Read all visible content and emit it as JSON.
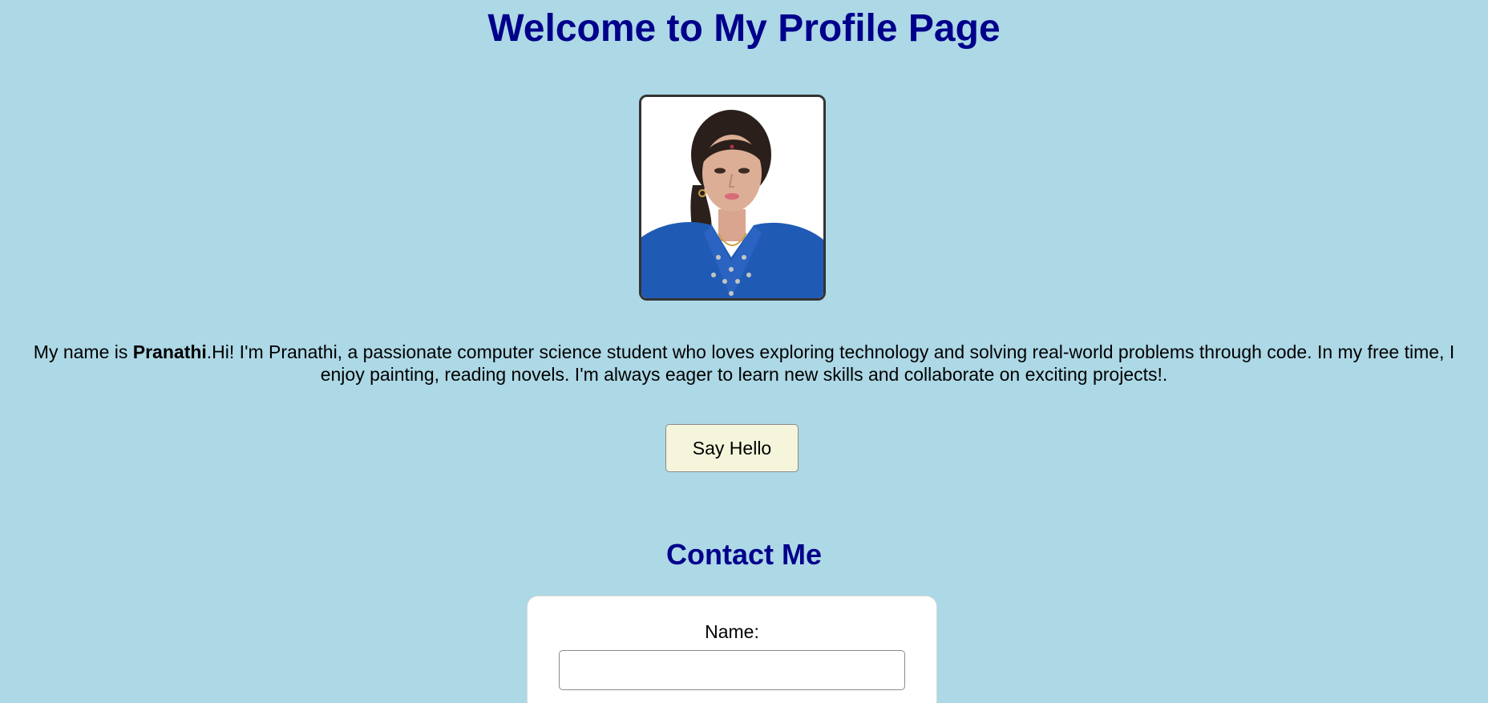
{
  "header": {
    "title": "Welcome to My Profile Page"
  },
  "profile": {
    "photo_alt": "Profile photo of Pranathi",
    "bio_prefix": "My name is ",
    "bio_name": "Pranathi",
    "bio_text": ".Hi! I'm Pranathi, a passionate computer science student who loves exploring technology and solving real-world problems through code. In my free time, I enjoy painting, reading novels. I'm always eager to learn new skills and collaborate on exciting projects!."
  },
  "actions": {
    "say_hello_label": "Say Hello"
  },
  "contact": {
    "heading": "Contact Me",
    "name_label": "Name:",
    "name_value": ""
  },
  "colors": {
    "background": "#add8e6",
    "heading": "#00008b",
    "button_bg": "#f5f5dc",
    "card_bg": "#ffffff"
  }
}
